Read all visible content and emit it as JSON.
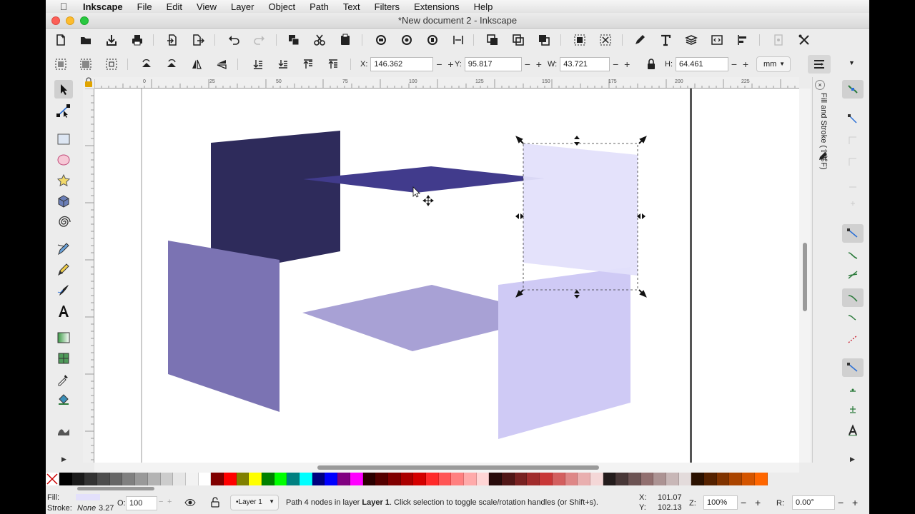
{
  "macos_menu": {
    "app_name": "Inkscape",
    "items": [
      "File",
      "Edit",
      "View",
      "Layer",
      "Object",
      "Path",
      "Text",
      "Filters",
      "Extensions",
      "Help"
    ]
  },
  "window": {
    "title": "*New document 2 - Inkscape"
  },
  "tool_controls": {
    "x_label": "X:",
    "x_value": "146.362",
    "y_label": "Y:",
    "y_value": "95.817",
    "w_label": "W:",
    "w_value": "43.721",
    "h_label": "H:",
    "h_value": "64.461",
    "unit": "mm",
    "minus": "−",
    "plus": "+"
  },
  "ruler_labels": [
    "0",
    "25",
    "50",
    "75",
    "100",
    "125",
    "150",
    "175",
    "200",
    "225"
  ],
  "dock": {
    "fill_stroke_label": "Fill and Stroke (⇧⌘F)"
  },
  "canvas_shapes_colors": {
    "dark_panel": "#2e2b5b",
    "flat_top": "#413b8c",
    "mid_panel": "#7b73b3",
    "flat_bottom": "#a8a1d5",
    "light_panel": "#cfcaf5",
    "selected_panel": "#e3e0fb"
  },
  "palette": [
    "#000000",
    "#1a1a1a",
    "#333333",
    "#4d4d4d",
    "#666666",
    "#808080",
    "#999999",
    "#b3b3b3",
    "#cccccc",
    "#e6e6e6",
    "#f2f2f2",
    "#ffffff",
    "#800000",
    "#ff0000",
    "#808000",
    "#ffff00",
    "#008000",
    "#00ff00",
    "#008080",
    "#00ffff",
    "#000080",
    "#0000ff",
    "#800080",
    "#ff00ff",
    "#2b0000",
    "#550000",
    "#800000",
    "#aa0000",
    "#d40000",
    "#ff2a2a",
    "#ff5555",
    "#ff8080",
    "#ffaaaa",
    "#ffd5d5",
    "#280b0b",
    "#501616",
    "#782121",
    "#a02c2c",
    "#c83737",
    "#d35f5f",
    "#de8787",
    "#e9afaf",
    "#f4d7d7",
    "#241c1c",
    "#483737",
    "#6c5353",
    "#916f6f",
    "#ac9393",
    "#c8b7b7",
    "#e3dbdb",
    "#2b1100",
    "#552200",
    "#803300",
    "#aa4400",
    "#d45500",
    "#ff6600"
  ],
  "status": {
    "fill_label": "Fill:",
    "stroke_label": "Stroke:",
    "stroke_value": "None",
    "stroke_width": "3.27",
    "opacity_label": "O:",
    "opacity_value": "100",
    "layer_name": "•Layer 1",
    "message_pre": "Path 4 nodes in layer ",
    "message_layer": "Layer 1",
    "message_post": ". Click selection to toggle scale/rotation handles (or Shift+s).",
    "cursor_x_label": "X:",
    "cursor_x": "101.07",
    "cursor_y_label": "Y:",
    "cursor_y": "102.13",
    "zoom_label": "Z:",
    "zoom_value": "100%",
    "rotate_label": "R:",
    "rotate_value": "0.00°"
  }
}
